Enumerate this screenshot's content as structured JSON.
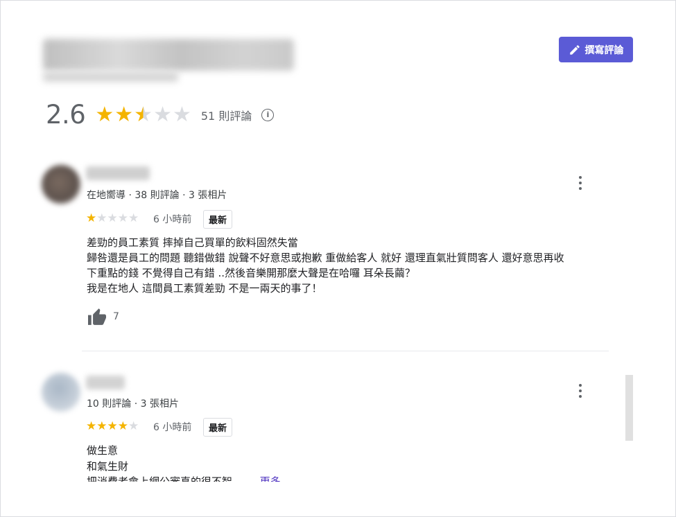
{
  "header": {
    "write_review_label": "撰寫評論"
  },
  "summary": {
    "rating": "2.6",
    "stars": 2.5,
    "review_count": "51 則評論",
    "info_icon": "i"
  },
  "reviews": [
    {
      "meta": "在地嚮導 · 38 則評論 · 3 張相片",
      "stars": 1,
      "time": "6 小時前",
      "badge": "最新",
      "text": "差勁的員工素質 摔掉自己買單的飲料固然失當\n歸咎還是員工的問題 聽錯做錯 說聲不好意思或抱歉 重做給客人 就好 還理直氣壯質問客人 還好意思再收\n下重點的錢 不覺得自己有錯 ..然後音樂開那麼大聲是在哈囉 耳朵長繭？\n我是在地人 這間員工素質差勁 不是一兩天的事了！",
      "likes": "7"
    },
    {
      "meta": "10 則評論 · 3 張相片",
      "stars": 4,
      "time": "6 小時前",
      "badge": "最新",
      "text_lines": [
        "做生意",
        "和氣生財"
      ],
      "truncated_line": "把消費者會上網公審真的很不智 ……",
      "more_label": "更多"
    }
  ]
}
